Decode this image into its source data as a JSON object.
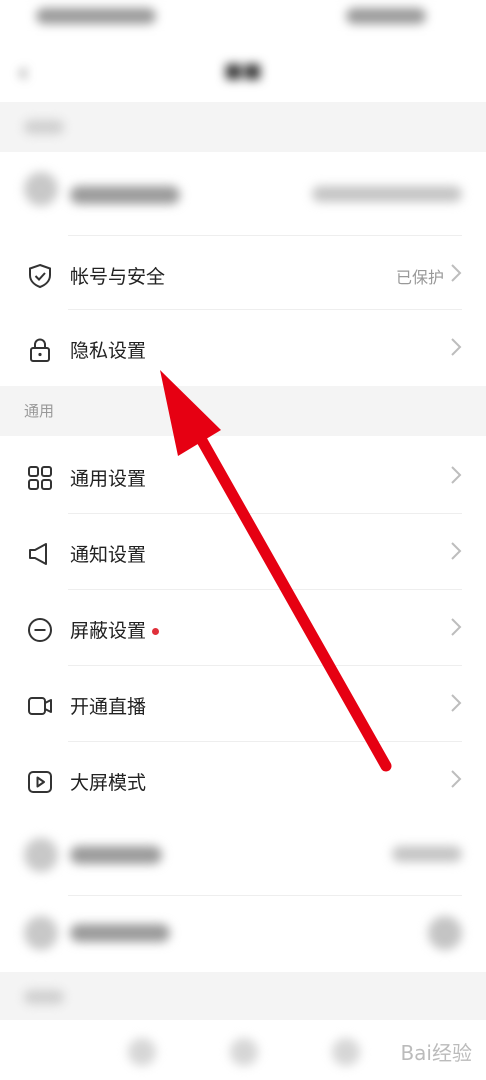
{
  "general_header": "通用",
  "account_rows": [
    {
      "label": "帐号与安全",
      "value": "已保护",
      "icon": "shield-icon"
    },
    {
      "label": "隐私设置",
      "value": "",
      "icon": "lock-icon"
    }
  ],
  "general_rows": [
    {
      "label": "通用设置",
      "value": "",
      "icon": "grid-icon"
    },
    {
      "label": "通知设置",
      "value": "",
      "icon": "speaker-icon"
    },
    {
      "label": "屏蔽设置",
      "value": "",
      "icon": "block-icon",
      "dot": true
    },
    {
      "label": "开通直播",
      "value": "",
      "icon": "camera-icon"
    },
    {
      "label": "大屏模式",
      "value": "",
      "icon": "play-icon"
    }
  ],
  "watermark": "Bai经验",
  "annotation_color": "#e60012"
}
